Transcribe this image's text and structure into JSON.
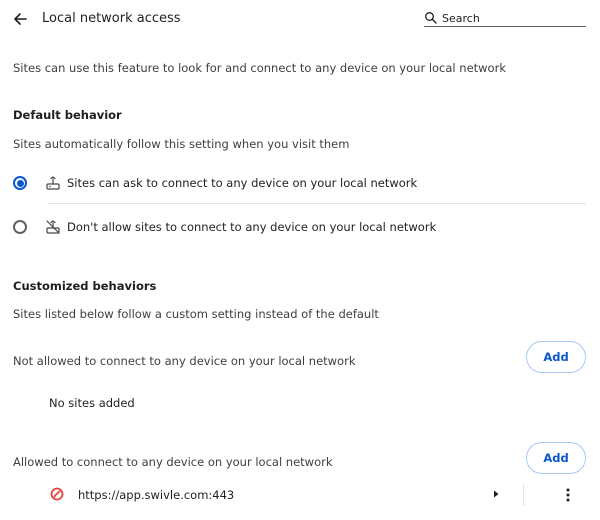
{
  "header": {
    "title": "Local network access",
    "search_placeholder": "Search"
  },
  "description": "Sites can use this feature to look for and connect to any device on your local network",
  "default_behavior": {
    "heading": "Default behavior",
    "subtext": "Sites automatically follow this setting when you visit them",
    "options": [
      {
        "label": "Sites can ask to connect to any device on your local network",
        "selected": true,
        "icon": "network-device-icon"
      },
      {
        "label": "Don't allow sites to connect to any device on your local network",
        "selected": false,
        "icon": "network-device-off-icon"
      }
    ]
  },
  "customized": {
    "heading": "Customized behaviors",
    "subtext": "Sites listed below follow a custom setting instead of the default",
    "not_allowed": {
      "label": "Not allowed to connect to any device on your local network",
      "add_label": "Add",
      "empty_text": "No sites added"
    },
    "allowed": {
      "label": "Allowed to connect to any device on your local network",
      "add_label": "Add",
      "sites": [
        {
          "url": "https://app.swivle.com:443",
          "icon": "swivle-favicon"
        }
      ]
    }
  },
  "colors": {
    "accent": "#0b57d0",
    "button_border": "#a8c7fa",
    "favicon": "#e8453c"
  }
}
